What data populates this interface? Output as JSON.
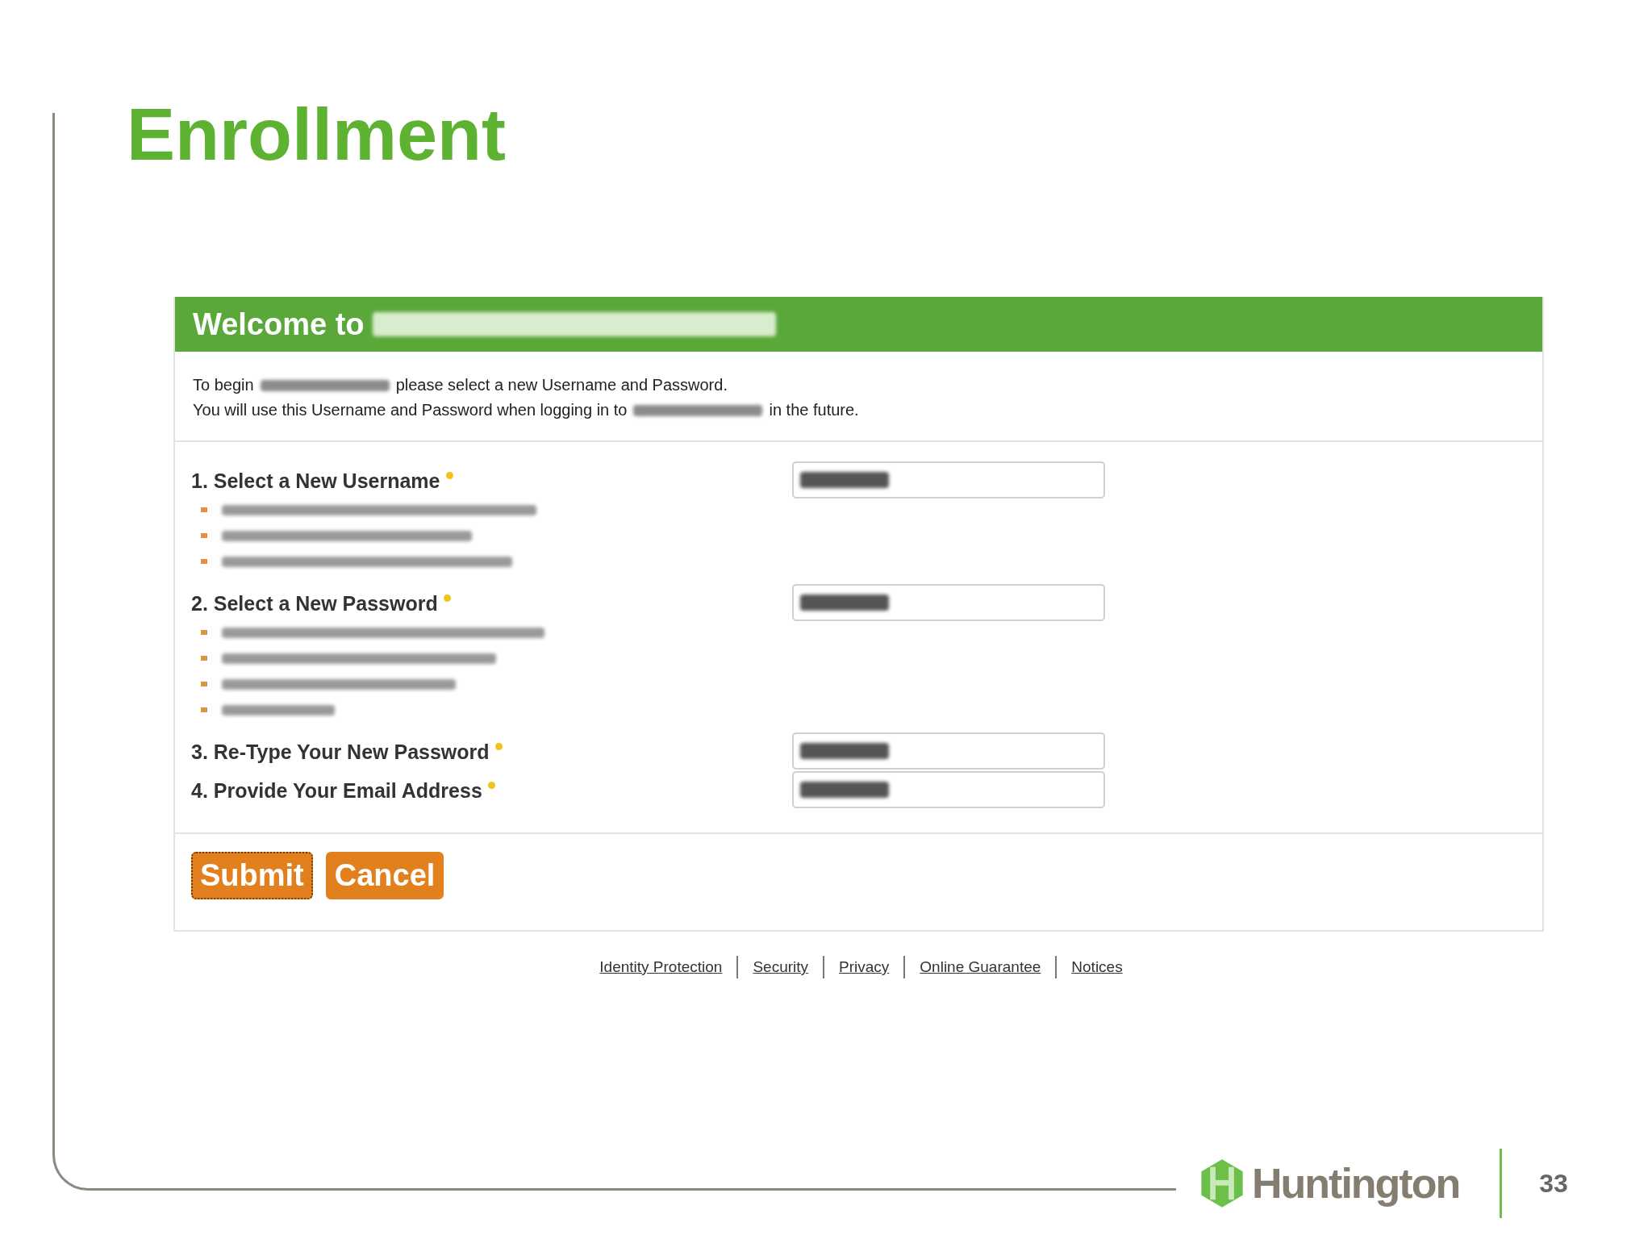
{
  "slide": {
    "title": "Enrollment",
    "page_number": "33",
    "logo_text": "Huntington"
  },
  "form": {
    "header": [
      {
        "kind": "text",
        "text": "Welcome to"
      },
      {
        "kind": "redacted"
      }
    ],
    "intro": [
      [
        {
          "kind": "text",
          "text": "To begin"
        },
        {
          "kind": "redacted"
        },
        {
          "kind": "text",
          "text": "please select a new Username and Password."
        }
      ],
      [
        {
          "kind": "text",
          "text": "You will use this Username and Password when logging in to"
        },
        {
          "kind": "redacted"
        },
        {
          "kind": "text",
          "text": "in the future."
        }
      ]
    ],
    "fields": [
      {
        "label": "1. Select a New Username",
        "required": true,
        "hints": [
          {
            "kind": "redacted"
          },
          {
            "kind": "redacted"
          },
          {
            "kind": "redacted"
          }
        ]
      },
      {
        "label": "2. Select a New Password",
        "required": true,
        "hints": [
          {
            "kind": "redacted"
          },
          {
            "kind": "redacted"
          },
          {
            "kind": "redacted"
          },
          {
            "kind": "redacted"
          }
        ]
      },
      {
        "label": "3. Re-Type Your New Password",
        "required": true
      },
      {
        "label": "4. Provide Your Email Address",
        "required": true
      }
    ],
    "buttons": [
      {
        "label": "Submit",
        "focused": true
      },
      {
        "label": "Cancel",
        "focused": false
      }
    ]
  },
  "footer_links": [
    "Identity Protection",
    "Security",
    "Privacy",
    "Online Guarantee",
    "Notices"
  ]
}
